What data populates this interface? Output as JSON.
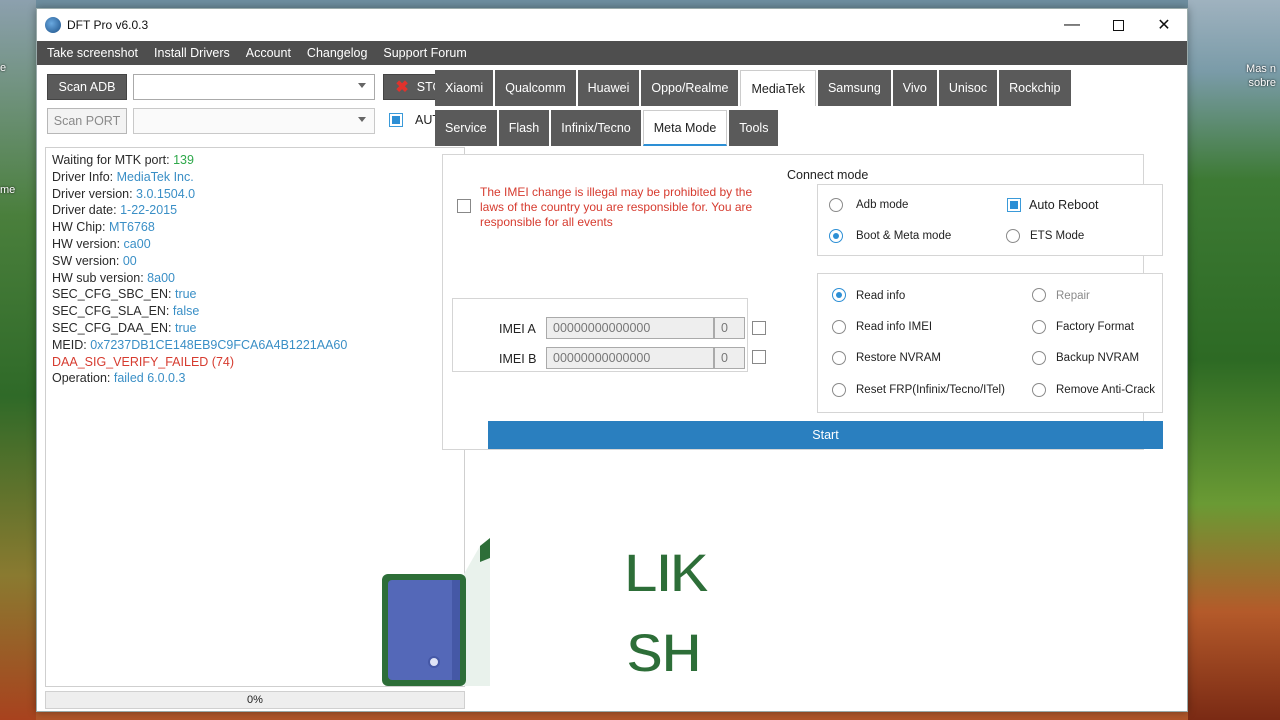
{
  "desktop": {
    "right_text": "Mas n sobre",
    "left_text_top": "e",
    "left_text_mid": "me"
  },
  "window": {
    "title": "DFT Pro v6.0.3",
    "controls": {
      "minimize": "—",
      "close": "✕"
    }
  },
  "menu": [
    "Take screenshot",
    "Install Drivers",
    "Account",
    "Changelog",
    "Support Forum"
  ],
  "left": {
    "scan_adb": "Scan ADB",
    "scan_port": "Scan PORT",
    "stop": "STOP",
    "auto": "AUTO",
    "progress": "0%",
    "log": [
      {
        "k": "Waiting for MTK port: ",
        "v": "139",
        "c": "g"
      },
      {
        "k": "Driver Info: ",
        "v": "MediaTek Inc.",
        "c": "v"
      },
      {
        "k": "Driver version: ",
        "v": "3.0.1504.0",
        "c": "v"
      },
      {
        "k": "Driver date: ",
        "v": "1-22-2015",
        "c": "v"
      },
      {
        "k": "HW Chip: ",
        "v": "MT6768",
        "c": "v"
      },
      {
        "k": "HW version: ",
        "v": "ca00",
        "c": "v"
      },
      {
        "k": "SW version: ",
        "v": "00",
        "c": "v"
      },
      {
        "k": "HW sub version: ",
        "v": "8a00",
        "c": "v"
      },
      {
        "k": "SEC_CFG_SBC_EN: ",
        "v": "true",
        "c": "v"
      },
      {
        "k": "SEC_CFG_SLA_EN: ",
        "v": "false",
        "c": "v"
      },
      {
        "k": "SEC_CFG_DAA_EN: ",
        "v": "true",
        "c": "v"
      },
      {
        "k": "MEID: ",
        "v": "0x7237DB1CE148EB9C9FCA6A4B1221AA60",
        "c": "v"
      },
      {
        "k": "",
        "v": "DAA_SIG_VERIFY_FAILED (74)",
        "c": "err"
      },
      {
        "k": "Operation: ",
        "v": "failed 6.0.0.3",
        "c": "v"
      }
    ]
  },
  "tabs": [
    "Xiaomi",
    "Qualcomm",
    "Huawei",
    "Oppo/Realme",
    "MediaTek",
    "Samsung",
    "Vivo",
    "Unisoc",
    "Rockchip"
  ],
  "subtabs": [
    "Service",
    "Flash",
    "Infinix/Tecno",
    "Meta Mode",
    "Tools"
  ],
  "active_tab": "MediaTek",
  "active_subtab": "Meta Mode",
  "warning": "The IMEI change is illegal may be prohibited by the laws of the country you are responsible for. You are responsible for all events",
  "imei": {
    "a_label": "IMEI A",
    "a_value": "00000000000000",
    "a_count": "0",
    "b_label": "IMEI B",
    "b_value": "00000000000000",
    "b_count": "0"
  },
  "connect_mode": {
    "title": "Connect mode",
    "adb": "Adb mode",
    "boot_meta": "Boot & Meta mode",
    "auto_reboot": "Auto Reboot",
    "ets": "ETS Mode"
  },
  "operations": {
    "read_info": "Read info",
    "repair": "Repair",
    "read_info_imei": "Read info IMEI",
    "factory_format": "Factory Format",
    "restore_nvram": "Restore NVRAM",
    "backup_nvram": "Backup NVRAM",
    "reset_frp": "Reset FRP(Infinix/Tecno/ITel)",
    "remove_anticrack": "Remove Anti-Crack"
  },
  "start": "Start",
  "overlay": {
    "like": "LIK",
    "share": "SH"
  },
  "colors": {
    "accent": "#2d8fd5",
    "start": "#2a7fbf",
    "error": "#d63b2f",
    "tab_bg": "#5a5a5a"
  }
}
